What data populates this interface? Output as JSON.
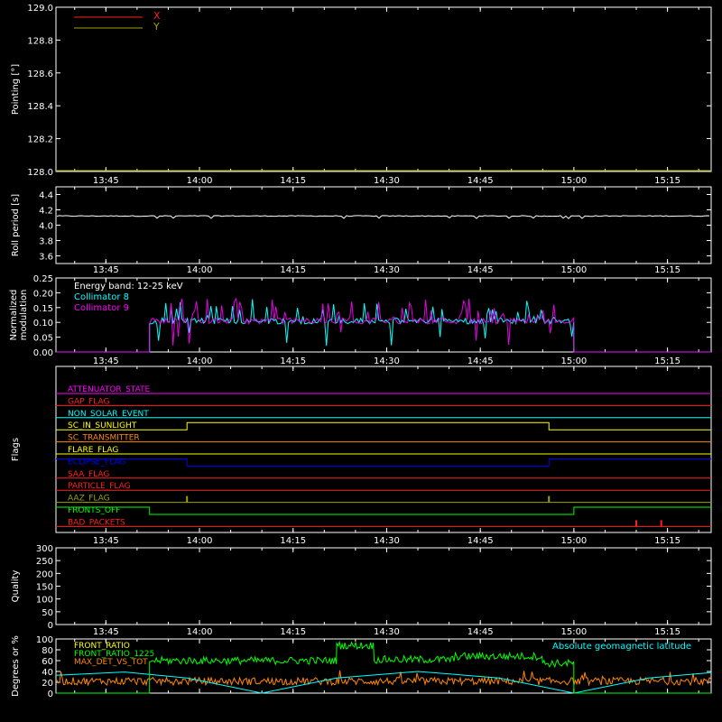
{
  "time_ticks": [
    "13:45",
    "14:00",
    "14:15",
    "14:30",
    "14:45",
    "15:00",
    "15:15"
  ],
  "colors": {
    "background": "#000000",
    "axes": "#ffffff",
    "red": "#ff2020",
    "olive": "#a0a000",
    "cyan": "#00ffff",
    "magenta": "#ff00ff",
    "green": "#00ff00",
    "orange": "#ff8800",
    "blue": "#0000ff",
    "yellow": "#ffff00"
  },
  "chart_data": [
    {
      "type": "line",
      "ylabel": "Pointing [°]",
      "ylim": [
        128.0,
        129.0
      ],
      "yticks": [
        "128.0",
        "128.2",
        "128.4",
        "128.6",
        "128.8",
        "129.0"
      ],
      "legend": [
        "X",
        "Y"
      ],
      "legend_position": "top-left",
      "series": [
        {
          "name": "X",
          "color": "#ff2020",
          "values": []
        },
        {
          "name": "Y",
          "color": "#a0a000",
          "values": []
        }
      ]
    },
    {
      "type": "line",
      "ylabel": "Roll period [s]",
      "ylim": [
        3.5,
        4.5
      ],
      "yticks": [
        "3.6",
        "3.8",
        "4.0",
        "4.2",
        "4.4"
      ],
      "series": [
        {
          "color": "#ffffff",
          "x": [
            "13:37",
            "15:22"
          ],
          "values": [
            4.12,
            4.12
          ]
        }
      ]
    },
    {
      "type": "line",
      "ylabel": "Normalized modulation",
      "ylim": [
        0.0,
        0.25
      ],
      "yticks": [
        "0.00",
        "0.05",
        "0.10",
        "0.15",
        "0.20",
        "0.25"
      ],
      "annotation": "Energy band: 12-25 keV",
      "legend": [
        "Collimator 8",
        "Collimator 9"
      ],
      "legend_position": "top-left",
      "series": [
        {
          "name": "Collimator 8",
          "color": "#00ffff",
          "active": [
            "13:52",
            "15:00"
          ],
          "base": 0.1
        },
        {
          "name": "Collimator 9",
          "color": "#ff00ff",
          "active": [
            "13:52",
            "15:00"
          ],
          "base": 0.1
        }
      ]
    },
    {
      "type": "line",
      "ylabel": "Flags",
      "flags": [
        {
          "name": "ATTENUATOR_STATE",
          "color": "#ff00ff",
          "transitions": []
        },
        {
          "name": "GAP_FLAG",
          "color": "#ff2020",
          "transitions": []
        },
        {
          "name": "NON_SOLAR_EVENT",
          "color": "#00ffff",
          "transitions": []
        },
        {
          "name": "SC_IN_SUNLIGHT",
          "color": "#ffff00",
          "low": [
            "13:37",
            "13:58"
          ],
          "high": [
            "13:58",
            "14:56"
          ],
          "low2": [
            "14:56",
            "15:22"
          ]
        },
        {
          "name": "SC_TRANSMITTER",
          "color": "#ff8800",
          "transitions": []
        },
        {
          "name": "FLARE_FLAG",
          "color": "#ffff00",
          "transitions": []
        },
        {
          "name": "ECLIPSE_FLAG",
          "color": "#0000ff",
          "high": [
            "13:37",
            "13:58"
          ],
          "low": [
            "13:58",
            "14:56"
          ],
          "high2": [
            "14:56",
            "15:22"
          ]
        },
        {
          "name": "SAA_FLAG",
          "color": "#ff2020",
          "transitions": []
        },
        {
          "name": "PARTICLE_FLAG",
          "color": "#ff2020",
          "transitions": []
        },
        {
          "name": "AAZ_FLAG",
          "color": "#a0a000",
          "spikes": [
            "13:58",
            "14:56"
          ]
        },
        {
          "name": "FRONTS_OFF",
          "color": "#00ff00",
          "high": [
            "13:37",
            "13:52"
          ],
          "low": [
            "13:52",
            "15:00"
          ],
          "high2": [
            "15:00",
            "15:22"
          ]
        },
        {
          "name": "BAD_PACKETS",
          "color": "#ff2020",
          "spikes": [
            "15:10",
            "15:14"
          ]
        }
      ]
    },
    {
      "type": "line",
      "ylabel": "Quality",
      "ylim": [
        0,
        300
      ],
      "yticks": [
        "0",
        "50",
        "100",
        "150",
        "200",
        "250",
        "300"
      ],
      "series": [
        {
          "color": "#ffffff",
          "x": [
            "13:37",
            "15:22"
          ],
          "values": [
            0,
            0
          ]
        }
      ]
    },
    {
      "type": "line",
      "ylabel": "Degrees or %",
      "ylim": [
        0,
        100
      ],
      "yticks": [
        "0",
        "20",
        "40",
        "60",
        "80",
        "100"
      ],
      "legend": [
        "FRONT_RATIO",
        "FRONT_RATIO_1225",
        "MAX_DET_VS_TOT"
      ],
      "legend_position": "top-left",
      "annotation": "Absolute geomagnetic latitude",
      "series": [
        {
          "name": "FRONT_RATIO",
          "color": "#ffff00",
          "values": []
        },
        {
          "name": "FRONT_RATIO_1225",
          "color": "#00ff00",
          "segments": [
            {
              "x": [
                "13:52",
                "14:22"
              ],
              "value": 60
            },
            {
              "x": [
                "14:22",
                "14:28"
              ],
              "value": 88
            },
            {
              "x": [
                "14:28",
                "14:41"
              ],
              "value": 62
            },
            {
              "x": [
                "14:41",
                "14:55"
              ],
              "value": 68
            },
            {
              "x": [
                "14:55",
                "15:00"
              ],
              "value": 55
            }
          ]
        },
        {
          "name": "MAX_DET_VS_TOT",
          "color": "#ff8800",
          "base": 22
        },
        {
          "name": "Absolute geomagnetic latitude",
          "color": "#00ffff",
          "points": [
            {
              "x": "13:37",
              "y": 33
            },
            {
              "x": "13:48",
              "y": 39
            },
            {
              "x": "13:58",
              "y": 28
            },
            {
              "x": "14:10",
              "y": 0
            },
            {
              "x": "14:22",
              "y": 28
            },
            {
              "x": "14:35",
              "y": 40
            },
            {
              "x": "14:48",
              "y": 28
            },
            {
              "x": "15:00",
              "y": 0
            },
            {
              "x": "15:12",
              "y": 28
            },
            {
              "x": "15:22",
              "y": 38
            }
          ]
        }
      ]
    }
  ]
}
